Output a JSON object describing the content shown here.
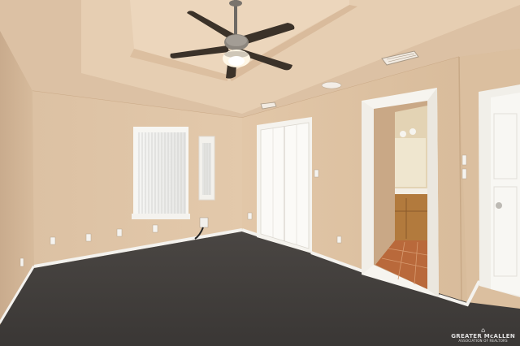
{
  "photo": {
    "watermark": {
      "name": "GREATER McALLEN",
      "subtitle": "ASSOCIATION OF REALTORS",
      "logo_icon": "roof-icon"
    }
  }
}
